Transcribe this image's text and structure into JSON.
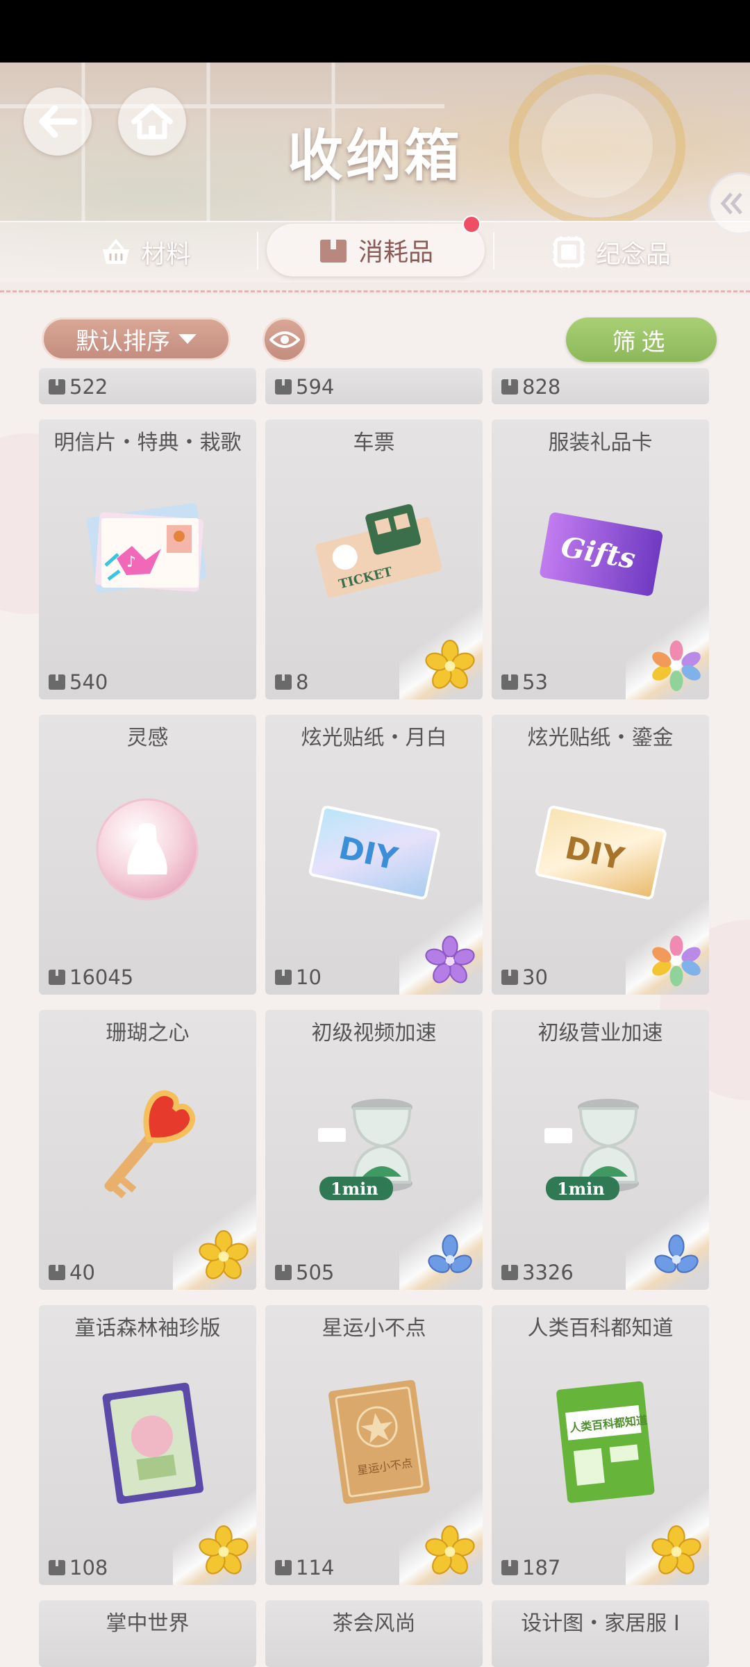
{
  "header": {
    "title": "收纳箱",
    "back_icon": "arrow-left-icon",
    "home_icon": "home-icon"
  },
  "tabs": [
    {
      "label": "材料",
      "icon": "basket-icon",
      "active": false
    },
    {
      "label": "消耗品",
      "icon": "box-icon",
      "active": true,
      "badge": true
    },
    {
      "label": "纪念品",
      "icon": "frame-icon",
      "active": false
    }
  ],
  "toolbar": {
    "sort_label": "默认排序",
    "filter_label": "筛选"
  },
  "colors": {
    "accent_sort": "#c9968a",
    "accent_filter": "#97c364",
    "badge": "#ef4f62",
    "rarity_gold": "#f2c531",
    "rarity_purple": "#b57ee6",
    "rarity_blue": "#6e9be6"
  },
  "partial_top_row": [
    "522",
    "594",
    "828"
  ],
  "items": [
    {
      "name": "明信片・特典・栽歌",
      "qty": "540",
      "art": "postcard-stack",
      "rarity": "none"
    },
    {
      "name": "车票",
      "qty": "8",
      "art": "ticket",
      "rarity": "gold"
    },
    {
      "name": "服装礼品卡",
      "qty": "53",
      "art": "gift-card",
      "rarity": "rainbow"
    },
    {
      "name": "灵感",
      "qty": "16045",
      "art": "inspiration-orb",
      "rarity": "none"
    },
    {
      "name": "炫光贴纸・月白",
      "qty": "10",
      "art": "diy-sticker-blue",
      "rarity": "purple"
    },
    {
      "name": "炫光贴纸・鎏金",
      "qty": "30",
      "art": "diy-sticker-gold",
      "rarity": "rainbow"
    },
    {
      "name": "珊瑚之心",
      "qty": "40",
      "art": "heart-key",
      "rarity": "gold"
    },
    {
      "name": "初级视频加速",
      "qty": "505",
      "art": "hourglass-1min",
      "rarity": "blue"
    },
    {
      "name": "初级营业加速",
      "qty": "3326",
      "art": "hourglass-1min",
      "rarity": "blue"
    },
    {
      "name": "童话森林袖珍版",
      "qty": "108",
      "art": "book-fairy-forest",
      "rarity": "gold"
    },
    {
      "name": "星运小不点",
      "qty": "114",
      "art": "book-star",
      "rarity": "gold"
    },
    {
      "name": "人类百科都知道",
      "qty": "187",
      "art": "book-encyclopedia",
      "rarity": "gold"
    }
  ],
  "partial_bottom_row": [
    "掌中世界",
    "茶会风尚",
    "设计图・家居服 I"
  ],
  "art_text": {
    "ticket": "TICKET",
    "gift": "Gifts",
    "diy": "DIY",
    "min": "1min",
    "book2": "星运小不点",
    "book3": "人类百科都知道"
  }
}
